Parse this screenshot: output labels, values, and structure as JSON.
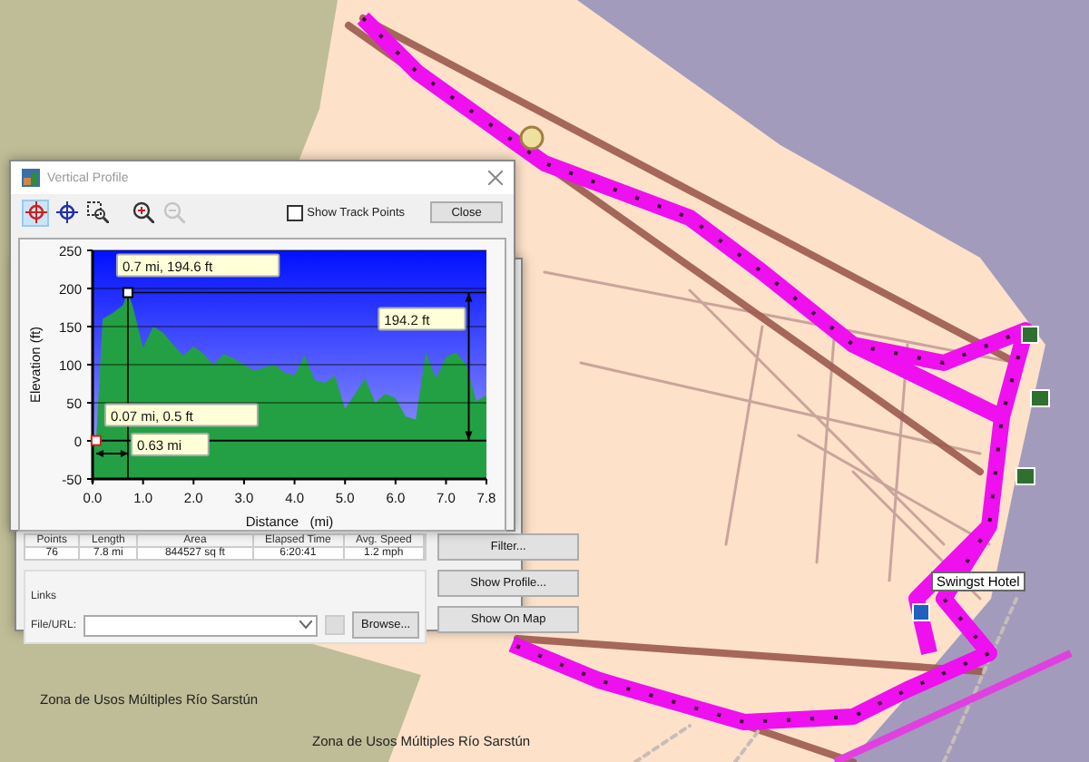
{
  "map": {
    "labels": [
      {
        "text": "Zona de Usos Múltiples Río Sarstún",
        "kind": "area"
      },
      {
        "text": "Zona de Usos Múltiples Río Sarstún",
        "kind": "area"
      },
      {
        "text": "Swingst Hotel",
        "kind": "poi"
      }
    ]
  },
  "profile_window": {
    "title": "Vertical Profile",
    "tools": [
      {
        "kind": "crosshair",
        "selected": true,
        "disabled": false
      },
      {
        "kind": "target",
        "selected": false,
        "disabled": false
      },
      {
        "kind": "zoom-rect",
        "selected": false,
        "disabled": false
      },
      {
        "kind": "zoom-in",
        "selected": false,
        "disabled": false
      },
      {
        "kind": "zoom-out",
        "selected": false,
        "disabled": true
      }
    ],
    "show_track_points": {
      "label": "Show Track Points",
      "checked": false
    },
    "close_button": "Close",
    "chart_data": {
      "type": "area",
      "xlabel": "Distance   (mi)",
      "ylabel": "Elevation (ft)",
      "x": [
        0,
        0.07,
        0.2,
        0.4,
        0.6,
        0.7,
        0.8,
        1.0,
        1.2,
        1.4,
        1.6,
        1.8,
        2.0,
        2.2,
        2.4,
        2.6,
        2.8,
        3.0,
        3.2,
        3.4,
        3.6,
        3.8,
        4.0,
        4.2,
        4.4,
        4.6,
        4.8,
        5.0,
        5.2,
        5.4,
        5.6,
        5.8,
        6.0,
        6.2,
        6.4,
        6.6,
        6.8,
        7.0,
        7.2,
        7.4,
        7.6,
        7.8
      ],
      "series": [
        {
          "color": "#23a043",
          "values": [
            0,
            0.5,
            160,
            168,
            178,
            194.6,
            176,
            122,
            150,
            142,
            126,
            112,
            124,
            114,
            100,
            114,
            108,
            100,
            92,
            96,
            100,
            90,
            86,
            112,
            80,
            76,
            86,
            42,
            62,
            82,
            50,
            62,
            56,
            32,
            28,
            116,
            82,
            110,
            116,
            100,
            52,
            60
          ]
        }
      ],
      "xlim": [
        0,
        7.8
      ],
      "ylim": [
        -50,
        250
      ],
      "xticks": [
        {
          "value": 0,
          "label": "0.0"
        },
        {
          "value": 1,
          "label": "1.0"
        },
        {
          "value": 2,
          "label": "2.0"
        },
        {
          "value": 3,
          "label": "3.0"
        },
        {
          "value": 4,
          "label": "4.0"
        },
        {
          "value": 5,
          "label": "5.0"
        },
        {
          "value": 6,
          "label": "6.0"
        },
        {
          "value": 7,
          "label": "7.0"
        },
        {
          "value": 7.8,
          "label": "7.8"
        }
      ],
      "yticks": [
        250,
        200,
        150,
        100,
        50,
        0,
        -50
      ],
      "grid": true,
      "annotations": [
        {
          "text": "0.7 mi, 194.6 ft",
          "x": 0.7,
          "y": 194.6
        },
        {
          "text": "0.07 mi, 0.5 ft",
          "x": 0.07,
          "y": 0.5
        },
        "0.63 mi",
        "194.2 ft"
      ]
    }
  },
  "track_window": {
    "stats": {
      "columns": [
        "Points",
        "Length",
        "Area",
        "Elapsed Time",
        "Avg. Speed"
      ],
      "values": [
        "76",
        "7.8 mi",
        "844527 sq ft",
        "6:20:41",
        "1.2 mph"
      ]
    },
    "links_label": "Links",
    "file_label": "File/URL:",
    "browse_button": "Browse...",
    "buttons": [
      "Filter...",
      "Show Profile...",
      "Show On Map"
    ]
  }
}
